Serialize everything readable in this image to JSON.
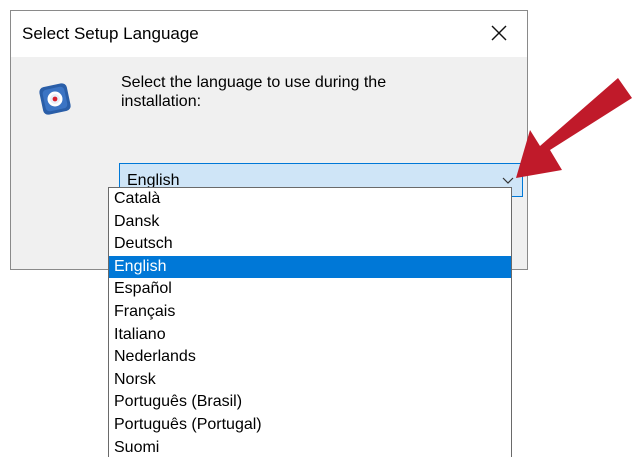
{
  "window": {
    "title": "Select Setup Language",
    "close_icon": "close-icon",
    "app_icon": "setup-app-icon"
  },
  "prompt": "Select the language to use during the installation:",
  "combo": {
    "value": "English",
    "icon": "chevron-down-icon"
  },
  "dropdown": {
    "options": [
      "Català",
      "Dansk",
      "Deutsch",
      "English",
      "Español",
      "Français",
      "Italiano",
      "Nederlands",
      "Norsk",
      "Português (Brasil)",
      "Português (Portugal)",
      "Suomi"
    ],
    "selected": "English"
  },
  "annotation": {
    "icon": "pointer-arrow-icon",
    "color": "#c01a2a"
  },
  "colors": {
    "selection": "#0078d7",
    "combo_background": "#cfe5f7",
    "dialog_background": "#f0f0f0"
  }
}
